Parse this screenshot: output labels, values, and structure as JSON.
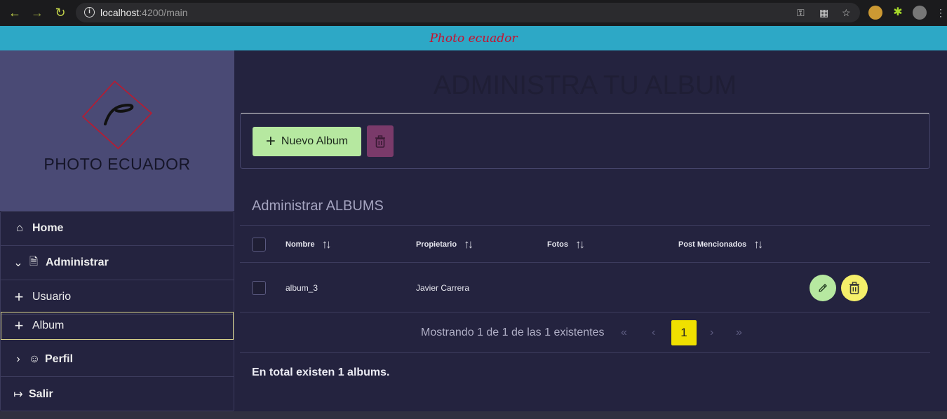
{
  "browser": {
    "url_host": "localhost",
    "url_rest": ":4200/main"
  },
  "app": {
    "brand": "Photo ecuador",
    "logo_text": "PHOTO ECUADOR"
  },
  "sidebar": {
    "items": [
      {
        "label": "Home"
      },
      {
        "label": "Administrar"
      },
      {
        "label": "Usuario"
      },
      {
        "label": "Album"
      },
      {
        "label": "Perfil"
      },
      {
        "label": "Salir"
      }
    ]
  },
  "main": {
    "title": "ADMINISTRA TU ALBUM",
    "new_button": "Nuevo Album",
    "section_title": "Administrar ALBUMS",
    "columns": [
      "Nombre",
      "Propietario",
      "Fotos",
      "Post Mencionados"
    ],
    "rows": [
      {
        "nombre": "album_3",
        "propietario": "Javier Carrera",
        "fotos": "",
        "post": ""
      }
    ],
    "pager": {
      "text": "Mostrando 1 de 1 de las 1 existentes",
      "current": "1"
    },
    "summary": "En total existen 1 albums."
  },
  "colors": {
    "appbar": "#2da8c6",
    "new_button": "#b6e8a0",
    "delete_button": "#7a3a6a",
    "edit_round": "#b6e8a0",
    "delete_round": "#f5ef6a",
    "pager_current": "#f0e000"
  }
}
